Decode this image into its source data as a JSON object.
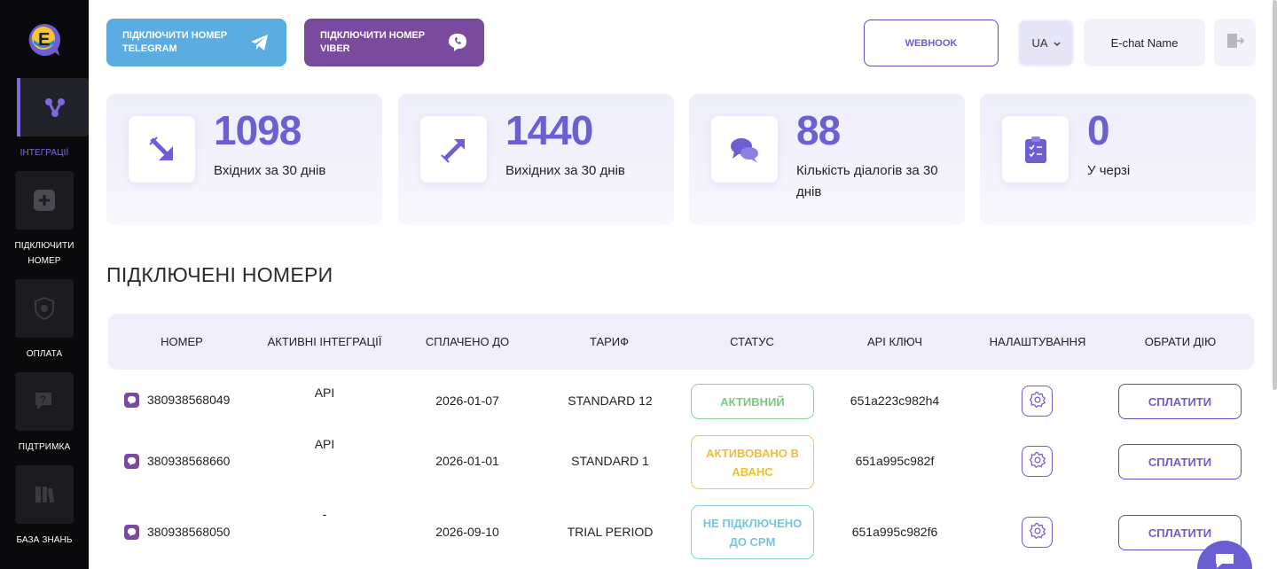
{
  "sidebar": {
    "items": [
      {
        "label": "ІНТЕГРАЦІЇ",
        "icon": "integrations-icon",
        "active": true
      },
      {
        "label": "ПІДКЛЮЧИТИ НОМЕР",
        "icon": "plus-icon",
        "active": false
      },
      {
        "label": "ОПЛАТА",
        "icon": "shield-icon",
        "active": false
      },
      {
        "label": "ПІДТРИМКА",
        "icon": "question-chat-icon",
        "active": false
      },
      {
        "label": "БАЗА ЗНАНЬ",
        "icon": "books-icon",
        "active": false
      }
    ]
  },
  "header": {
    "telegram_button": "Підключити номер Telegram",
    "viber_button": "Підключити номер Viber",
    "webhook_button": "WEBHOOK",
    "language": "UA",
    "account_name": "E-chat Name"
  },
  "stats": [
    {
      "value": "1098",
      "label": "Вхідних за 30 днів",
      "icon": "incoming-arrow-icon"
    },
    {
      "value": "1440",
      "label": "Вихідних за 30 днів",
      "icon": "outgoing-arrow-icon"
    },
    {
      "value": "88",
      "label": "Кількість діалогів за 30 днів",
      "icon": "dialogs-icon"
    },
    {
      "value": "0",
      "label": "У черзі",
      "icon": "clipboard-icon"
    }
  ],
  "section_title": "ПІДКЛЮЧЕНІ НОМЕРИ",
  "table": {
    "columns": [
      "Номер",
      "Активні інтеграції",
      "Сплачено до",
      "Тариф",
      "Статус",
      "API ключ",
      "Налаштування",
      "Обрати дію"
    ],
    "rows": [
      {
        "number": "380938568049",
        "integrations": "API",
        "paid_until": "2026-01-07",
        "tariff": "STANDARD 12",
        "status": "Активний",
        "status_color": "green",
        "api_key": "651a223c982h4",
        "action": "Сплатити"
      },
      {
        "number": "380938568660",
        "integrations": "API",
        "paid_until": "2026-01-01",
        "tariff": "STANDARD 1",
        "status": "Активовано в аванс",
        "status_color": "yellow",
        "api_key": "651a995c982f",
        "action": "Сплатити"
      },
      {
        "number": "380938568050",
        "integrations": "-",
        "paid_until": "2026-09-10",
        "tariff": "TRIAL PERIOD",
        "status": "Не підключено до CPM",
        "status_color": "blue",
        "api_key": "651a995c982f6",
        "action": "Сплатити"
      }
    ]
  },
  "colors": {
    "accent": "#6d5ed4",
    "telegram": "#5aace1",
    "viber": "#7a4a9e",
    "sidebar": "#0a0a0c"
  }
}
